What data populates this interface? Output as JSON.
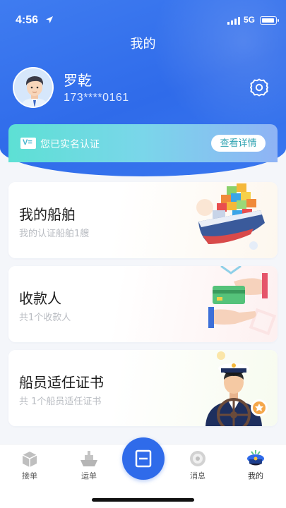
{
  "status_bar": {
    "time": "4:56",
    "network": "5G"
  },
  "header": {
    "title": "我的"
  },
  "profile": {
    "name": "罗乾",
    "phone": "173****0161"
  },
  "verification": {
    "icon_text": "V=",
    "text": "您已实名认证",
    "button_label": "查看详情"
  },
  "cards": [
    {
      "title": "我的船舶",
      "subtitle": "我的认证船舶1艘",
      "icon": "cargo-ship-icon"
    },
    {
      "title": "收款人",
      "subtitle": "共1个收款人",
      "icon": "card-payment-icon"
    },
    {
      "title": "船员适任证书",
      "subtitle": "共 1个船员适任证书",
      "icon": "captain-icon"
    }
  ],
  "tabbar": {
    "items": [
      {
        "label": "接单",
        "icon": "package-icon"
      },
      {
        "label": "运单",
        "icon": "ship-icon"
      },
      {
        "label": "消息",
        "icon": "message-icon"
      },
      {
        "label": "我的",
        "icon": "captain-hat-icon",
        "active": true
      }
    ],
    "center_icon": "scan-icon"
  },
  "colors": {
    "primary": "#2f6bea",
    "teal": "#5de0d4",
    "bg": "#f4f6fa"
  }
}
